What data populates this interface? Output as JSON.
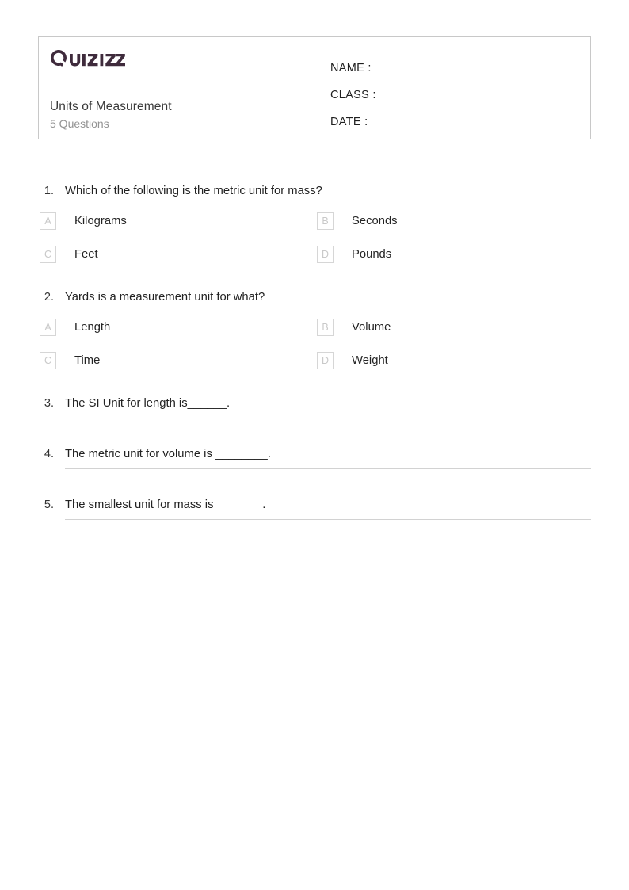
{
  "brand": {
    "name": "Quizizz",
    "logo_color": "#3f2b3c",
    "logo_icon": "quizizz-wordmark"
  },
  "header": {
    "quiz_title": "Units of Measurement",
    "question_count_label": "5 Questions",
    "fields": [
      {
        "label": "NAME :",
        "value": ""
      },
      {
        "label": "CLASS :",
        "value": ""
      },
      {
        "label": "DATE  :",
        "value": ""
      }
    ]
  },
  "questions": [
    {
      "number": "1.",
      "type": "multiple-choice",
      "text": "Which of the following is the metric unit for mass?",
      "options": [
        {
          "letter": "A",
          "text": "Kilograms"
        },
        {
          "letter": "B",
          "text": "Seconds"
        },
        {
          "letter": "C",
          "text": "Feet"
        },
        {
          "letter": "D",
          "text": "Pounds"
        }
      ]
    },
    {
      "number": "2.",
      "type": "multiple-choice",
      "text": "Yards is a measurement unit for what?",
      "options": [
        {
          "letter": "A",
          "text": "Length"
        },
        {
          "letter": "B",
          "text": "Volume"
        },
        {
          "letter": "C",
          "text": "Time"
        },
        {
          "letter": "D",
          "text": "Weight"
        }
      ]
    },
    {
      "number": "3.",
      "type": "fill-in-the-blank",
      "text": "The SI Unit for length is______."
    },
    {
      "number": "4.",
      "type": "fill-in-the-blank",
      "text": "The metric unit for volume is ________."
    },
    {
      "number": "5.",
      "type": "fill-in-the-blank",
      "text": "The smallest unit for mass is _______."
    }
  ],
  "colors": {
    "page_background": "#ffffff",
    "card_border": "#c8c8c8",
    "text_primary": "#222222",
    "text_muted": "#939393",
    "option_letter": "#c9c9c9",
    "rule_line": "#d2d2d2"
  }
}
